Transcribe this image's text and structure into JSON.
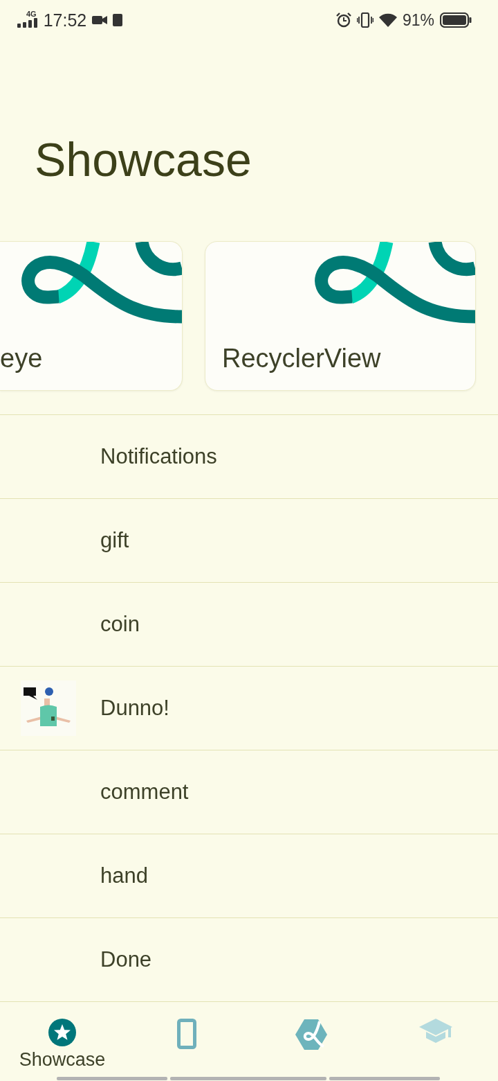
{
  "status_bar": {
    "network": "4G",
    "time": "17:52",
    "battery": "91%"
  },
  "title": "Showcase",
  "cards": [
    {
      "title": "eye"
    },
    {
      "title": "RecyclerView"
    }
  ],
  "rows": [
    {
      "label": "Notifications",
      "kind": "text"
    },
    {
      "label": "gift",
      "kind": "text"
    },
    {
      "label": "coin",
      "kind": "text"
    },
    {
      "label": "Dunno!",
      "kind": "picture"
    },
    {
      "label": "comment",
      "kind": "text"
    },
    {
      "label": "hand",
      "kind": "text"
    },
    {
      "label": "Done",
      "kind": "text"
    }
  ],
  "nav": [
    {
      "kind": "star",
      "label": "Showcase",
      "selected": true
    },
    {
      "kind": "phone",
      "selected": false
    },
    {
      "kind": "logo",
      "selected": false
    },
    {
      "kind": "cap",
      "selected": false
    }
  ]
}
